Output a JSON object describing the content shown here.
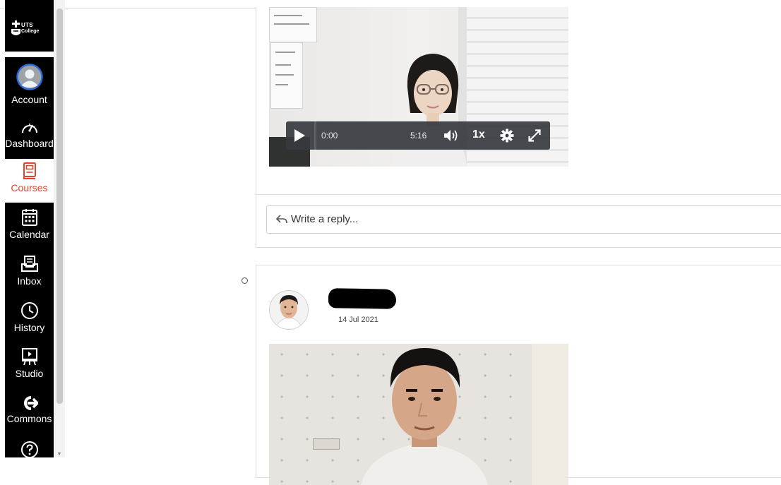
{
  "logo": {
    "line1": "UTS",
    "line2": "College"
  },
  "nav": {
    "items": [
      {
        "id": "account",
        "label": "Account",
        "icon": "avatar-icon",
        "active": false
      },
      {
        "id": "dashboard",
        "label": "Dashboard",
        "icon": "speedometer-icon",
        "active": false
      },
      {
        "id": "courses",
        "label": "Courses",
        "icon": "book-icon",
        "active": true
      },
      {
        "id": "calendar",
        "label": "Calendar",
        "icon": "calendar-icon",
        "active": false
      },
      {
        "id": "inbox",
        "label": "Inbox",
        "icon": "inbox-icon",
        "active": false
      },
      {
        "id": "history",
        "label": "History",
        "icon": "clock-icon",
        "active": false
      },
      {
        "id": "studio",
        "label": "Studio",
        "icon": "studio-icon",
        "active": false
      },
      {
        "id": "commons",
        "label": "Commons",
        "icon": "commons-arrow-icon",
        "active": false
      },
      {
        "id": "help",
        "label": "",
        "icon": "help-icon",
        "active": false
      }
    ]
  },
  "player": {
    "current_time": "0:00",
    "duration": "5:16",
    "playback_rate": "1x",
    "progress": 0
  },
  "reply": {
    "placeholder": "Write a reply..."
  },
  "post2": {
    "date": "14 Jul 2021"
  },
  "colors": {
    "nav_bg": "#000000",
    "active_text": "#e0452a",
    "border": "#dddddd"
  }
}
